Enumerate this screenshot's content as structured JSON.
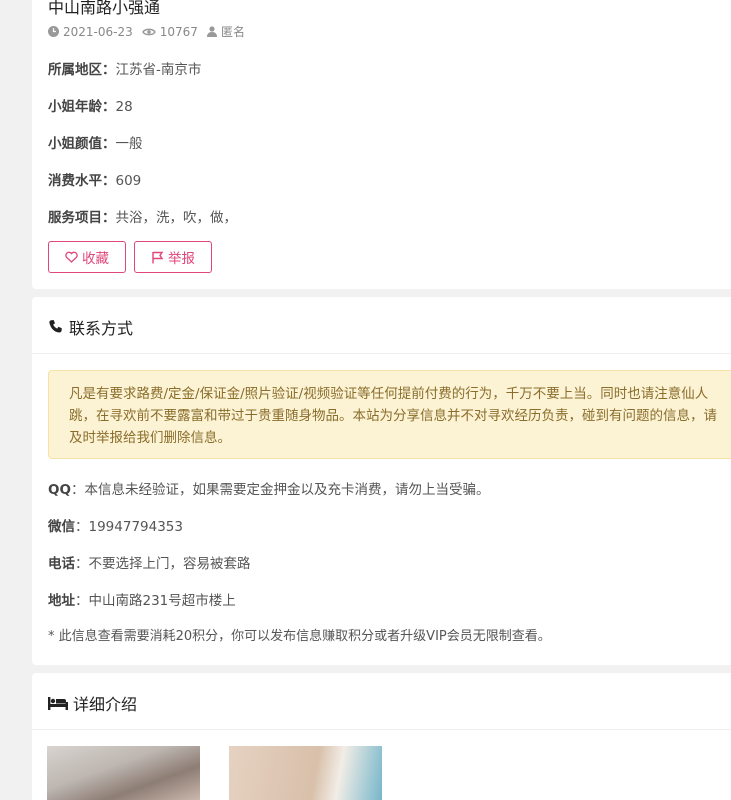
{
  "post": {
    "title": "中山南路小强通",
    "date": "2021-06-23",
    "views": "10767",
    "author": "匿名"
  },
  "fields": {
    "region": {
      "label": "所属地区：",
      "value": "江苏省-南京市"
    },
    "age": {
      "label": "小姐年龄：",
      "value": "28"
    },
    "looks": {
      "label": "小姐颜值：",
      "value": "一般"
    },
    "price": {
      "label": "消费水平：",
      "value": "609"
    },
    "services": {
      "label": "服务项目：",
      "value": "共浴，洗，吹，做，"
    }
  },
  "actions": {
    "favorite_label": "收藏",
    "report_label": "举报"
  },
  "contact": {
    "heading": "联系方式",
    "notice": "凡是有要求路费/定金/保证金/照片验证/视频验证等任何提前付费的行为，千万不要上当。同时也请注意仙人跳，在寻欢前不要露富和带过于贵重随身物品。本站为分享信息并不对寻欢经历负责，碰到有问题的信息，请及时举报给我们删除信息。",
    "qq": {
      "label": "QQ",
      "value": "：本信息未经验证，如果需要定金押金以及充卡消费，请勿上当受骗。"
    },
    "wechat": {
      "label": "微信",
      "value": "：19947794353"
    },
    "phone": {
      "label": "电话",
      "value": "：不要选择上门，容易被套路"
    },
    "address": {
      "label": "地址",
      "value": "：中山南路231号超市楼上"
    },
    "footnote": "* 此信息查看需要消耗20积分，你可以发布信息赚取积分或者升级VIP会员无限制查看。"
  },
  "detail": {
    "heading": "详细介绍"
  },
  "colors": {
    "accent": "#e0457b",
    "notice_bg": "#fcf3d4",
    "notice_text": "#8a6d2b"
  }
}
